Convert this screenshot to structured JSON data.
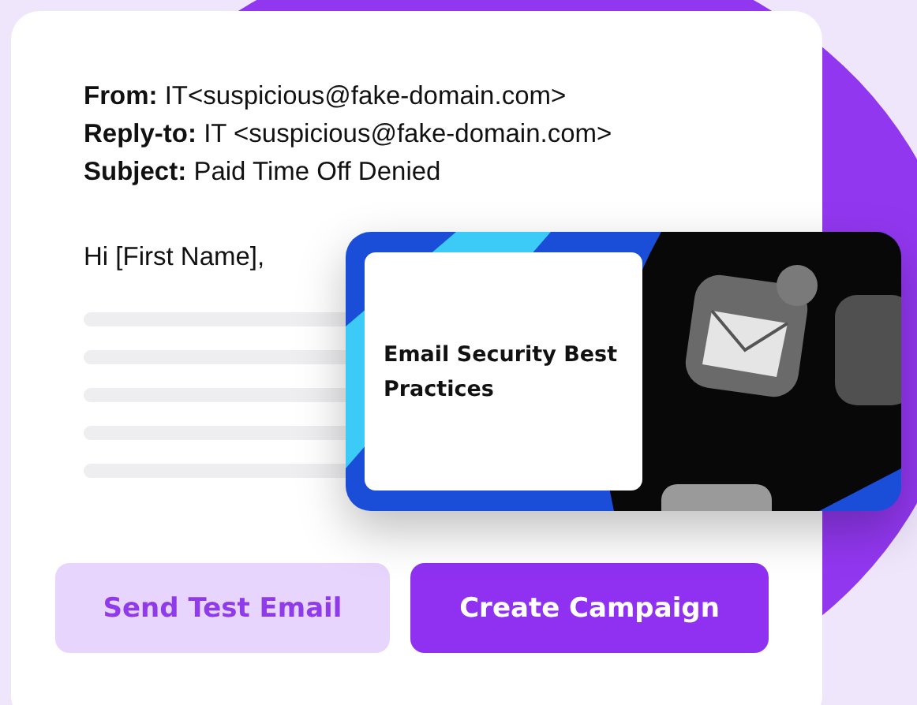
{
  "email": {
    "headers": [
      {
        "label": "From:",
        "value": "IT<suspicious@fake-domain.com>"
      },
      {
        "label": "Reply-to:",
        "value": "IT <suspicious@fake-domain.com>"
      },
      {
        "label": "Subject:",
        "value": "Paid Time Off Denied"
      }
    ],
    "greeting": "Hi [First Name],"
  },
  "training_card": {
    "title": "Email Security Best Practices",
    "kind": "picture"
  },
  "buttons": [
    {
      "label": "Send Test Email",
      "kind": "secondary"
    },
    {
      "label": "Create Campaign",
      "kind": "primary"
    }
  ]
}
